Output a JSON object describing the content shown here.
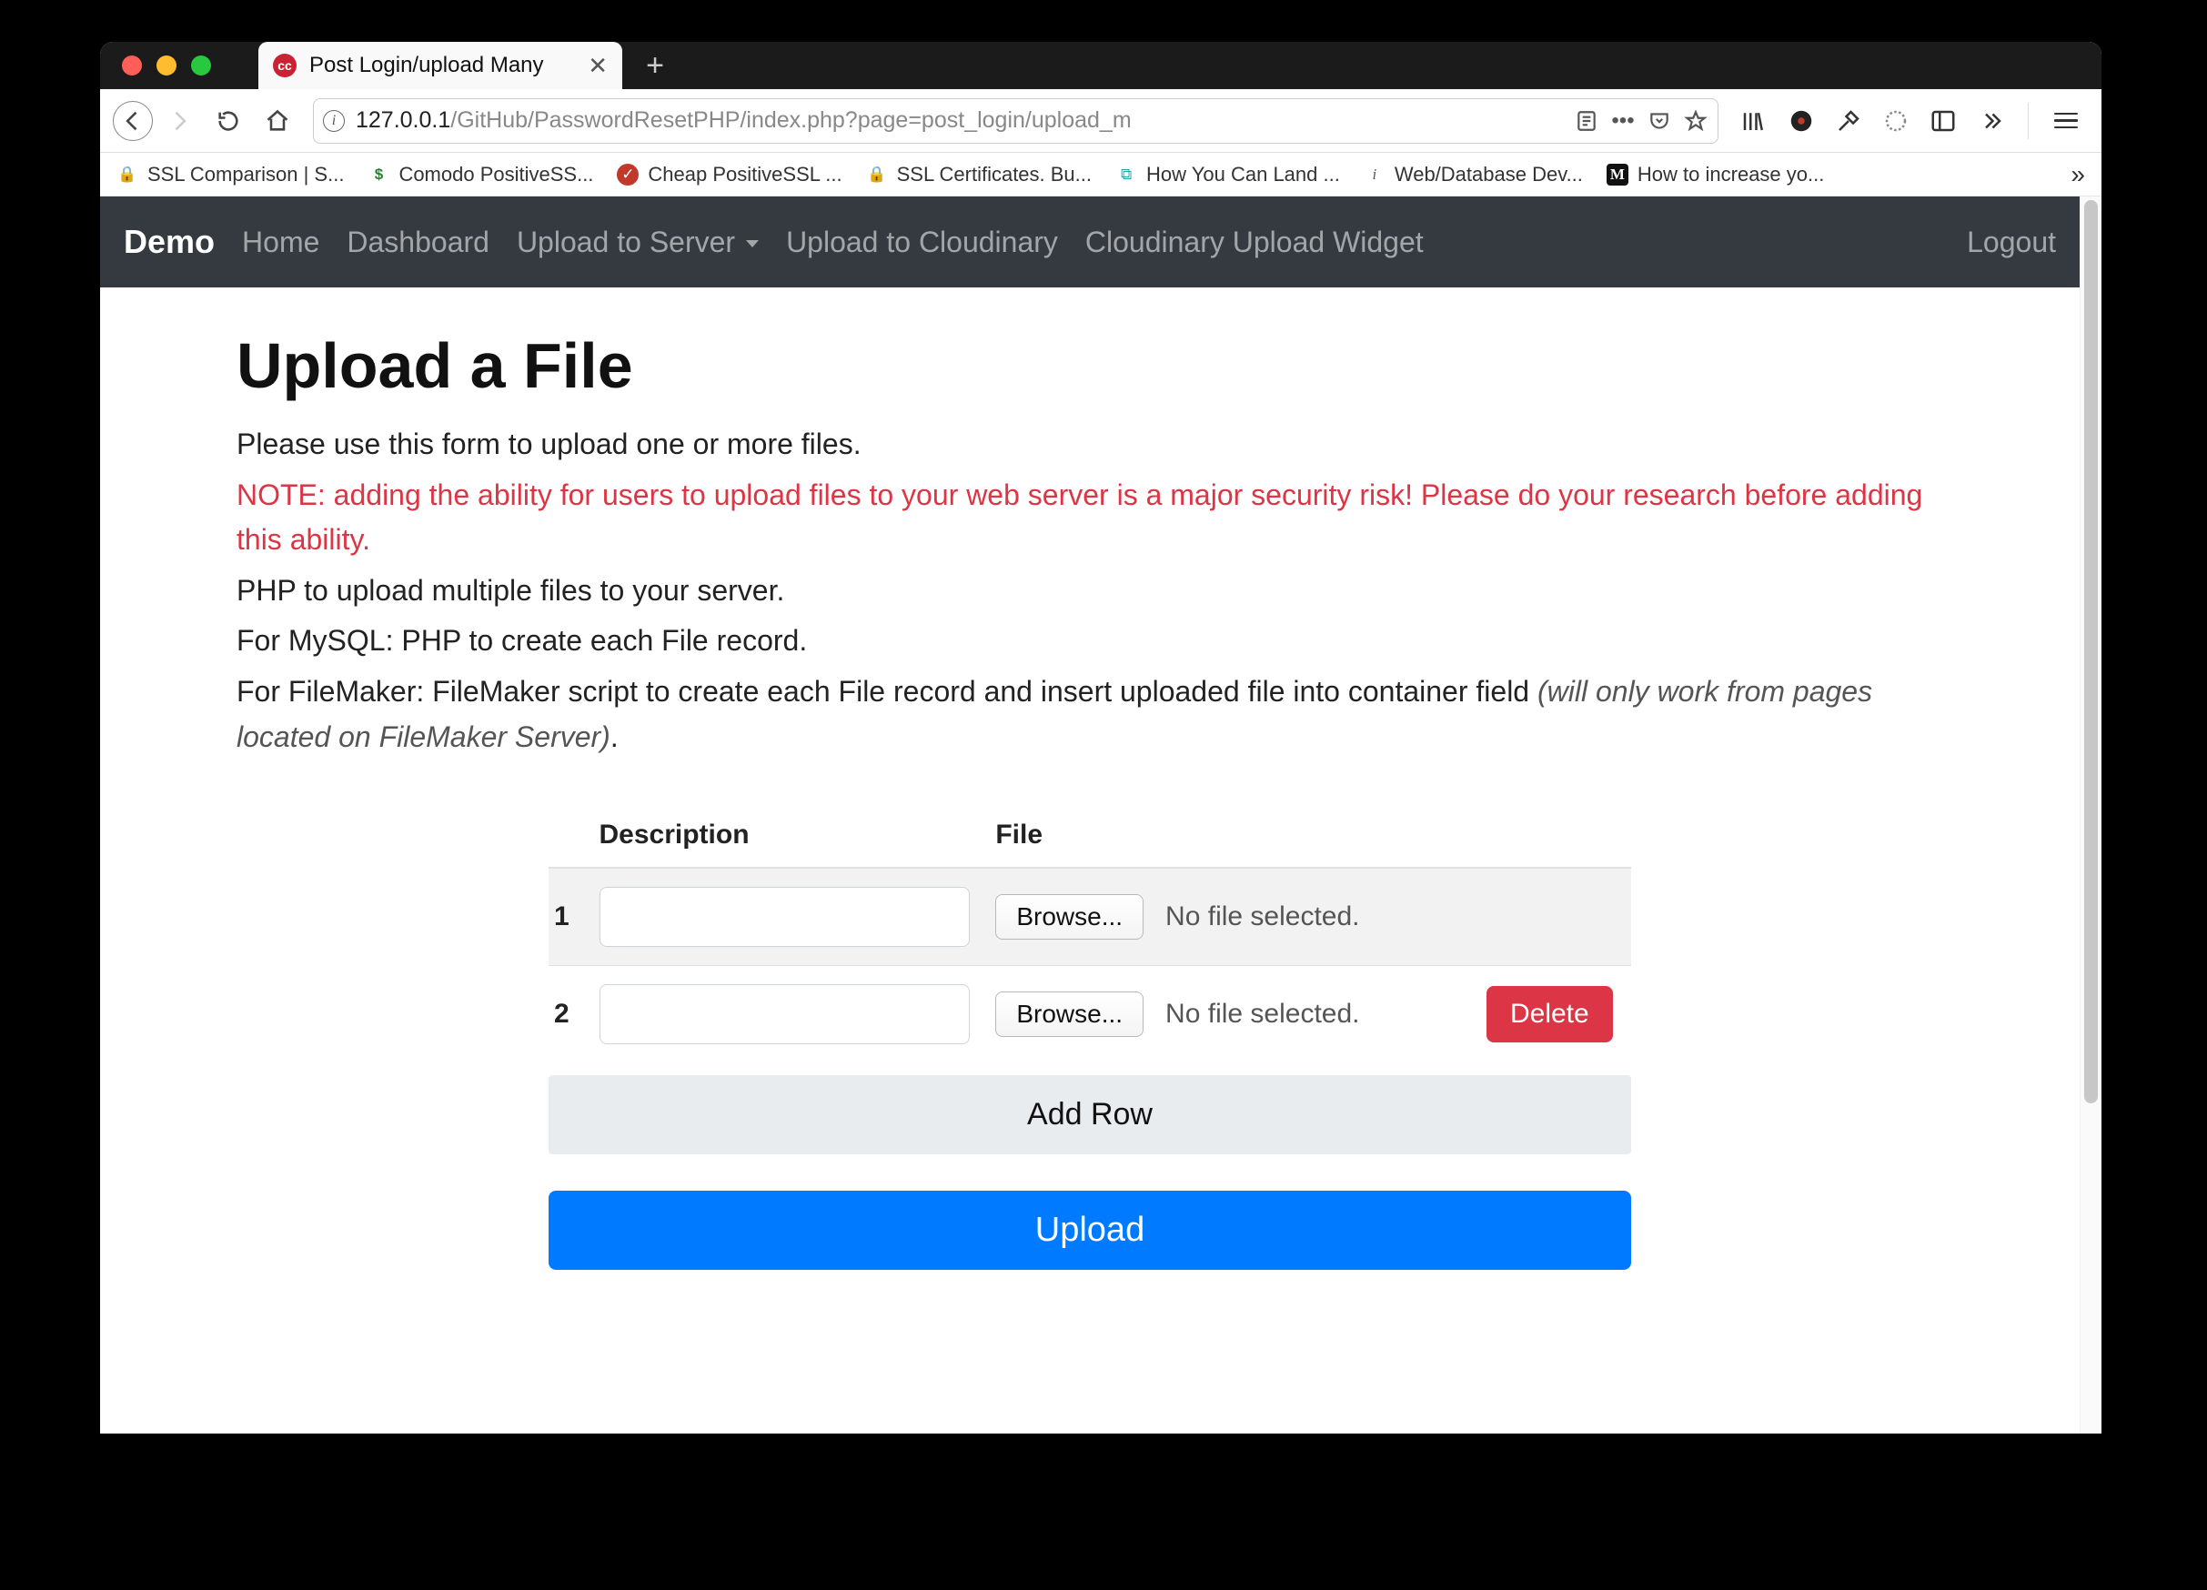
{
  "tab": {
    "title": "Post Login/upload Many"
  },
  "url": {
    "host": "127.0.0.1",
    "path": "/GitHub/PasswordResetPHP/index.php?page=post_login/upload_m"
  },
  "bookmarks": [
    {
      "icon": "lock",
      "label": "SSL Comparison | S..."
    },
    {
      "icon": "dollar",
      "label": "Comodo PositiveSS..."
    },
    {
      "icon": "shield",
      "label": "Cheap PositiveSSL ..."
    },
    {
      "icon": "lock",
      "label": "SSL Certificates. Bu..."
    },
    {
      "icon": "land",
      "label": "How You Can Land ..."
    },
    {
      "icon": "db",
      "label": "Web/Database Dev..."
    },
    {
      "icon": "medium",
      "label": "How to increase yo..."
    }
  ],
  "app_nav": {
    "brand": "Demo",
    "items": [
      "Home",
      "Dashboard",
      "Upload to Server",
      "Upload to Cloudinary",
      "Cloudinary Upload Widget"
    ],
    "dropdown_index": 2,
    "right": "Logout"
  },
  "content": {
    "heading": "Upload a File",
    "p1": "Please use this form to upload one or more files.",
    "p2": "NOTE: adding the ability for users to upload files to your web server is a major security risk! Please do your research before adding this ability.",
    "p3": "PHP to upload multiple files to your server.",
    "p4": "For MySQL: PHP to create each File record.",
    "p5a": "For FileMaker: FileMaker script to create each File record and insert uploaded file into container field ",
    "p5b": "(will only work from pages located on FileMaker Server)",
    "p5c": "."
  },
  "table": {
    "headers": {
      "num": "",
      "description": "Description",
      "file": "File",
      "action": ""
    },
    "rows": [
      {
        "num": "1",
        "description": "",
        "browse_label": "Browse...",
        "file_status": "No file selected.",
        "delete": false
      },
      {
        "num": "2",
        "description": "",
        "browse_label": "Browse...",
        "file_status": "No file selected.",
        "delete": true,
        "delete_label": "Delete"
      }
    ],
    "add_row": "Add Row",
    "upload": "Upload"
  }
}
